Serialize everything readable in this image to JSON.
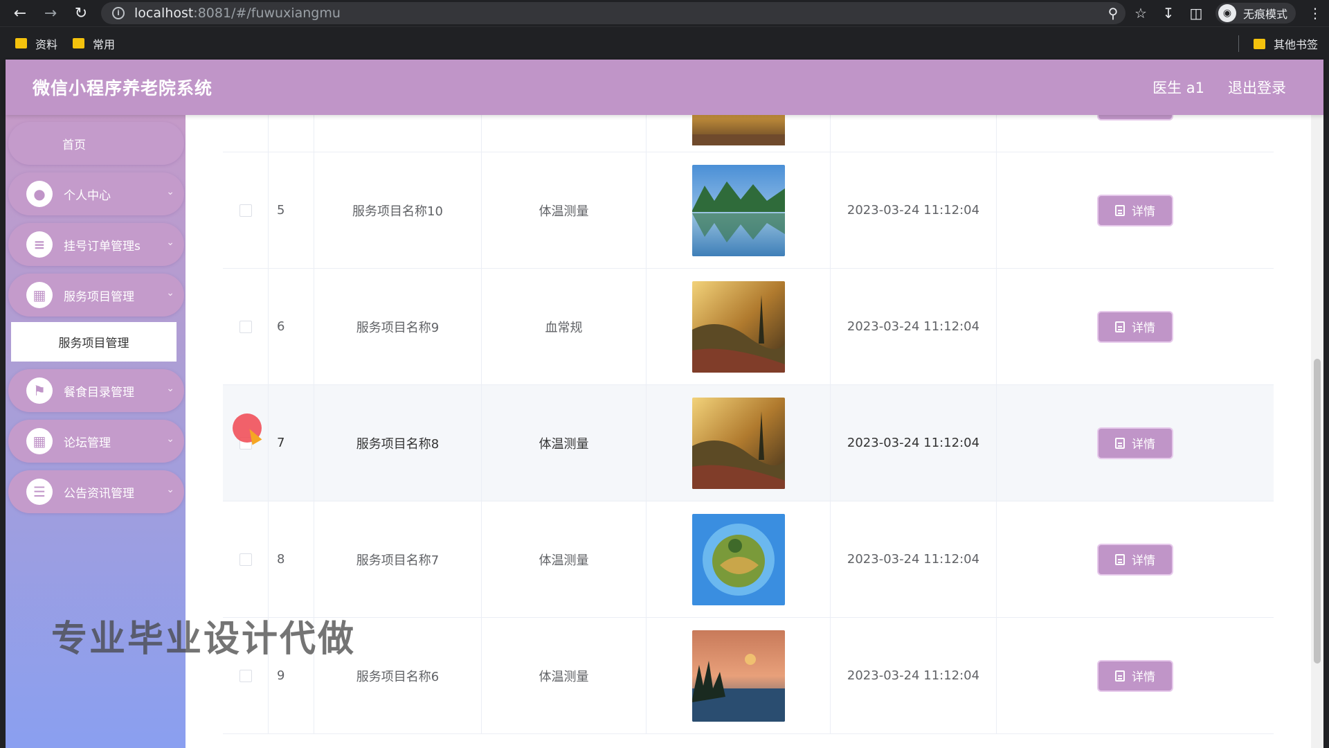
{
  "browser": {
    "url_host": "localhost",
    "url_rest": ":8081/#/fuwuxiangmu",
    "incognito_label": "无痕模式",
    "bookmarks": [
      "资料",
      "常用"
    ],
    "other_bookmarks": "其他书签"
  },
  "header": {
    "title": "微信小程序养老院系统",
    "user": "医生 a1",
    "logout": "退出登录"
  },
  "sidebar": {
    "home": "首页",
    "items": [
      {
        "label": "个人中心",
        "icon": "person-icon"
      },
      {
        "label": "挂号订单管理s",
        "icon": "sliders-icon"
      },
      {
        "label": "服务项目管理",
        "icon": "grid-icon"
      },
      {
        "label": "餐食目录管理",
        "icon": "flag-icon"
      },
      {
        "label": "论坛管理",
        "icon": "grid-icon"
      },
      {
        "label": "公告资讯管理",
        "icon": "list-icon"
      }
    ],
    "active_sub": "服务项目管理"
  },
  "table": {
    "detail_label": "详情",
    "rows": [
      {
        "index": "5",
        "name": "服务项目名称10",
        "type": "体温测量",
        "time": "2023-03-24 11:12:04",
        "image": "lake-mountains"
      },
      {
        "index": "6",
        "name": "服务项目名称9",
        "type": "血常规",
        "time": "2023-03-24 11:12:04",
        "image": "sunset-valley"
      },
      {
        "index": "7",
        "name": "服务项目名称8",
        "type": "体温测量",
        "time": "2023-03-24 11:12:04",
        "image": "sunset-valley"
      },
      {
        "index": "8",
        "name": "服务项目名称7",
        "type": "体温测量",
        "time": "2023-03-24 11:12:04",
        "image": "planet-sphere"
      },
      {
        "index": "9",
        "name": "服务项目名称6",
        "type": "体温测量",
        "time": "2023-03-24 11:12:04",
        "image": "dusk-lake"
      }
    ]
  },
  "watermark": "专业毕业设计代做",
  "colors": {
    "accent": "#c095c8",
    "sidebar_bottom": "#8a9ff0"
  }
}
